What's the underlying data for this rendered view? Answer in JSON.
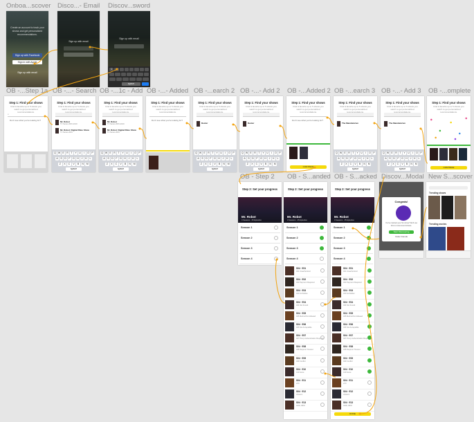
{
  "labels": {
    "onboarding_discover": "Onboa...scover",
    "discover_email": "Disco...- Email",
    "discover_password": "Discov...sword",
    "ob_step1a": "OB -...Step 1a",
    "ob_search": "OB -...- Search",
    "ob_1c_add": "OB -...1c - Add",
    "ob_added": "OB -...- Added",
    "ob_search2": "OB -...earch 2",
    "ob_add2": "OB -...- Add 2",
    "ob_added2": "OB -...Added 2",
    "ob_search3": "OB -...earch 3",
    "ob_add3": "OB -...- Add 3",
    "ob_complete": "OB -...omplete",
    "ob_step2": "OB - Step 2",
    "ob_s_anded": "OB - S...anded",
    "ob_s_acked": "OB - S...acked",
    "discover_modal": "Discov...Modal",
    "new_discover": "New S...scover"
  },
  "onboarding": {
    "blurb": "Create an account to track your shows and get personalized recommendations.",
    "facebook": "Sign up with Facebook",
    "apple": "Sign in with Apple",
    "email": "Sign up with email"
  },
  "email_screen": {
    "heading": "Sign up with email"
  },
  "password_screen": {
    "heading": "Sign up with email"
  },
  "step1": {
    "title": "Step 1: Find your shows",
    "subtitle": "Find & favorite up to 5 shows you watch to get personalized recommendations.",
    "no_result": "Don't see what you're looking for?",
    "result1_title": "Mr. Robot",
    "result1_sub": "TV Series 2015-2019",
    "result2_title": "Mr. Robot: Digital Rites Show",
    "result2_sub": "TV Series 2015",
    "result_dexter": "Dexter",
    "result_mandalorian": "The Mandalorian",
    "continue": "CONTINUE"
  },
  "step2": {
    "title": "Step 2: Set your progress",
    "show": "Mr. Robot",
    "show_sub": "4 Seasons · 45 Episodes",
    "seasons": [
      "Season 1",
      "Season 2",
      "Season 3",
      "Season 4"
    ],
    "episodes": [
      {
        "code": "S04 · E01",
        "name": "401 Unauthorized"
      },
      {
        "code": "S04 · E02",
        "name": "402 Payment Required"
      },
      {
        "code": "S04 · E03",
        "name": "403 Forbidden"
      },
      {
        "code": "S04 · E04",
        "name": "404 Not Found"
      },
      {
        "code": "S04 · E05",
        "name": "405 Method Not Allowed"
      },
      {
        "code": "S04 · E06",
        "name": "406 Not Acceptable"
      },
      {
        "code": "S04 · E07",
        "name": "407 Proxy Authentication Required"
      },
      {
        "code": "S04 · E08",
        "name": "408 Request Timeout"
      },
      {
        "code": "S04 · E09",
        "name": "409 Conflict"
      },
      {
        "code": "S04 · E10",
        "name": "410 Gone"
      },
      {
        "code": "S04 · E11",
        "name": "eXit"
      },
      {
        "code": "S04 · E12",
        "name": "whoami"
      },
      {
        "code": "S04 · E13",
        "name": "Hello, Elliot"
      }
    ],
    "done": "DONE"
  },
  "modal": {
    "title": "Congrats!",
    "body": "You've tracked your first show! We'll use this to recommend shows.",
    "primary": "Start Discovering",
    "secondary": "Invite Friends"
  },
  "discover": {
    "trending": "Trending shows",
    "popular": "Trending movies"
  },
  "keyboard": {
    "row1": [
      "Q",
      "W",
      "E",
      "R",
      "T",
      "Y",
      "U",
      "I",
      "O",
      "P"
    ],
    "row2": [
      "A",
      "S",
      "D",
      "F",
      "G",
      "H",
      "J",
      "K",
      "L"
    ],
    "row3": [
      "Z",
      "X",
      "C",
      "V",
      "B",
      "N",
      "M"
    ],
    "space": "space"
  },
  "colors": {
    "accent": "#f5d90a",
    "success": "#3db83b",
    "facebook": "#3b5998",
    "link": "#f2a30f"
  }
}
